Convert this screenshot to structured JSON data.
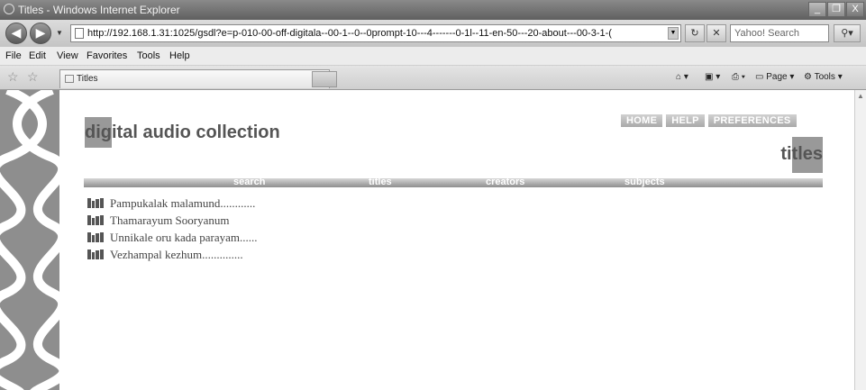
{
  "window": {
    "title": "Titles - Windows Internet Explorer",
    "buttons": {
      "minimize": "_",
      "restore": "❐",
      "close": "X"
    }
  },
  "toolbar": {
    "url": "http://192.168.1.31:1025/gsdl?e=p-010-00-off-digitala--00-1--0--0prompt-10---4-------0-1l--11-en-50---20-about---00-3-1-(",
    "search_placeholder": "Yahoo! Search"
  },
  "menu": [
    "File",
    "Edit",
    "View",
    "Favorites",
    "Tools",
    "Help"
  ],
  "tab": {
    "label": "Titles"
  },
  "command_bar": {
    "page": "Page",
    "tools": "Tools"
  },
  "page": {
    "logo_highlight": "dig",
    "logo_rest": "ital audio collection",
    "header_buttons": [
      "HOME",
      "HELP",
      "PREFERENCES"
    ],
    "page_title_plain": "ti",
    "page_title_highlight": "tles",
    "nav": [
      "search",
      "titles",
      "creators",
      "subjects"
    ],
    "titles": [
      "Pampukalak malamund............",
      "Thamarayum Sooryanum",
      "Unnikale oru kada parayam......",
      "Vezhampal kezhum.............."
    ]
  }
}
